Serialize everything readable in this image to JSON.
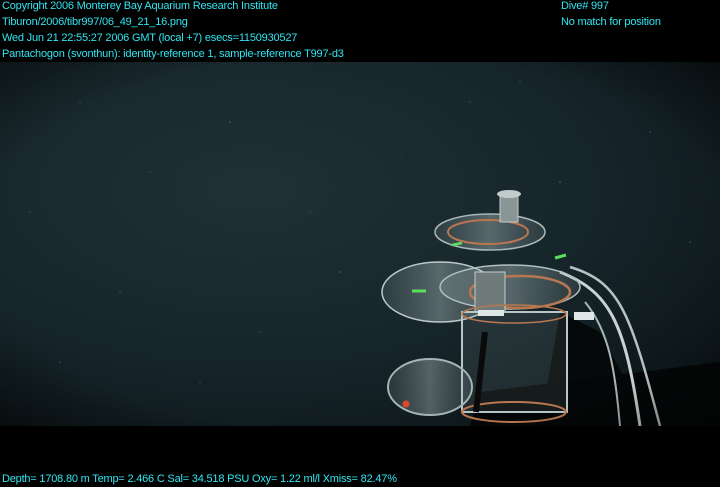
{
  "header_left": {
    "line1": "Copyright 2006 Monterey Bay Aquarium Research Institute",
    "line2": "Tiburon/2006/tibr997/06_49_21_16.png",
    "line3": "Wed Jun 21 22:55:27 2006 GMT (local +7)  esecs=1150930527",
    "line4": "Pantachogon (svonthun): identity-reference 1, sample-reference T997-d3"
  },
  "header_right": {
    "line1": "Dive# 997",
    "line2": "No match for position"
  },
  "footer": {
    "telemetry": "Depth= 1708.80 m  Temp= 2.466 C  Sal= 34.518 PSU  Oxy= 1.22 ml/l  Xmiss= 82.47%"
  },
  "colors": {
    "overlay_text": "#2fe6f2",
    "water": "#17262b"
  }
}
